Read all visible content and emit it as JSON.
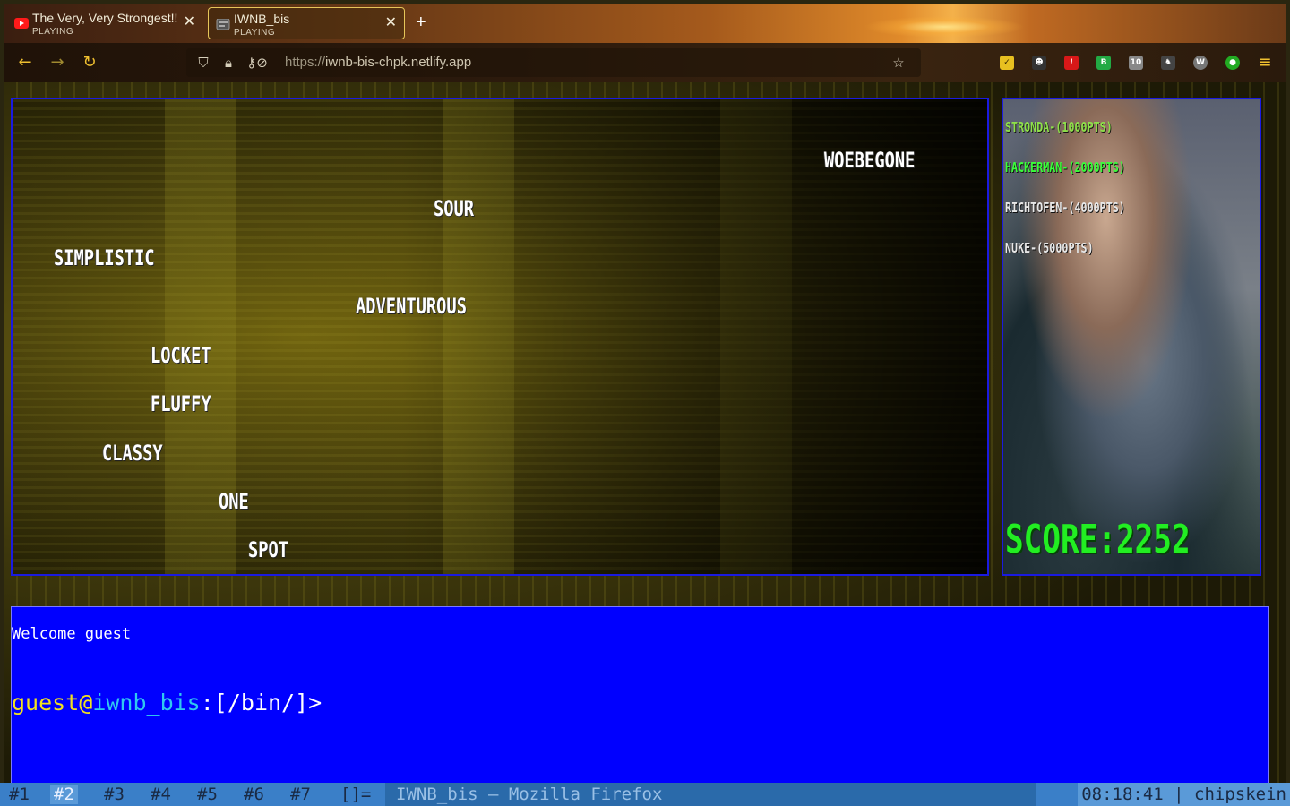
{
  "browser": {
    "tabs": [
      {
        "title": "The Very, Very Strongest!!",
        "status": "PLAYING",
        "icon": "youtube-icon"
      },
      {
        "title": "IWNB_bis",
        "status": "PLAYING",
        "icon": "site-favicon-icon"
      }
    ],
    "url_scheme": "https://",
    "url_host": "iwnb-bis-chpk.netlify.app"
  },
  "game": {
    "words": [
      {
        "text": "WOEBEGONE"
      },
      {
        "text": "SOUR"
      },
      {
        "text": "SIMPLISTIC"
      },
      {
        "text": "ADVENTUROUS"
      },
      {
        "text": "LOCKET"
      },
      {
        "text": "FLUFFY"
      },
      {
        "text": "CLASSY"
      },
      {
        "text": "ONE"
      },
      {
        "text": "SPOT"
      }
    ],
    "leaderboard": [
      {
        "label": "STRONDA-(1000PTS)",
        "color": "#8ee04a"
      },
      {
        "label": "HACKERMAN-(2000PTS)",
        "color": "#3aff3a"
      },
      {
        "label": "RICHTOFEN-(4000PTS)",
        "color": "#e8e8e8"
      },
      {
        "label": "NUKE-(5000PTS)",
        "color": "#e8e8e8"
      }
    ],
    "score": "SCORE:2252",
    "score_color": "#22ee22"
  },
  "terminal": {
    "welcome": "Welcome guest",
    "user": "guest",
    "at": "@",
    "host": "iwnb_bis",
    "path": ":[/bin/]>"
  },
  "taskbar": {
    "workspaces": [
      "#1",
      "#2",
      "#3",
      "#4",
      "#5",
      "#6",
      "#7",
      "[]="
    ],
    "active_workspace": "#2",
    "window_title": "IWNB_bis — Mozilla Firefox",
    "clock": "08:18:41 | chipskein"
  }
}
